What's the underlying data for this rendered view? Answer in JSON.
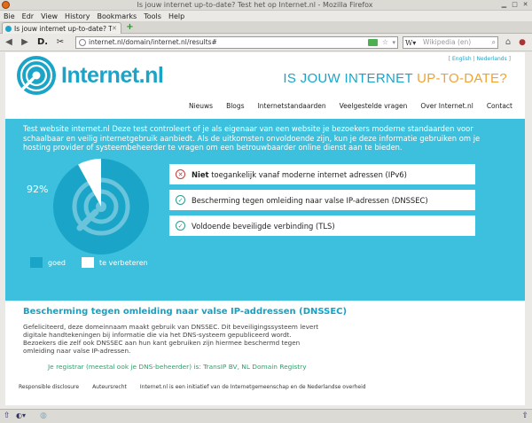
{
  "window": {
    "title": "Is jouw internet up-to-date? Test het op Internet.nl - Mozilla Firefox"
  },
  "menu": [
    "Bie",
    "Edr",
    "View",
    "History",
    "Bookmarks",
    "Tools",
    "Help"
  ],
  "tab": {
    "label": "Is jouw internet up-to-date? Test..."
  },
  "url": "internet.nl/domain/internet.nl/results#",
  "search": {
    "placeholder": "Wikipedia (en)"
  },
  "site": {
    "logo_text": "Internet.nl",
    "lang_prefix": "[ ",
    "lang_en": "English",
    "lang_sep": " | ",
    "lang_nl": "Nederlands",
    "lang_suffix": " ]",
    "tagline_main": "IS JOUW INTERNET ",
    "tagline_highlight": "UP-TO-DATE?",
    "nav": [
      "Nieuws",
      "Blogs",
      "Internetstandaarden",
      "Veelgestelde vragen",
      "Over Internet.nl",
      "Contact"
    ]
  },
  "intro": "Test website internet.nl Deze test controleert of je als eigenaar van een website je bezoekers moderne standaarden voor schaalbaar en veilig internetgebruik aanbiedt. Als de uitkomsten onvoldoende zijn, kun je deze informatie gebruiken om je hosting provider of systeembeheerder te vragen om een betrouwbaarder online dienst aan te bieden.",
  "score": {
    "label": "92%",
    "value": 92,
    "legend_good": "goed",
    "legend_improve": "te verbeteren"
  },
  "results": [
    {
      "status": "fail",
      "bold": "Niet",
      "text": " toegankelijk vanaf moderne internet adressen (IPv6)"
    },
    {
      "status": "ok",
      "bold": "",
      "text": "Bescherming tegen omleiding naar valse IP-adressen (DNSSEC)"
    },
    {
      "status": "ok",
      "bold": "",
      "text": "Voldoende beveiligde verbinding (TLS)"
    }
  ],
  "detail": {
    "heading": "Bescherming tegen omleiding naar valse IP-addressen (DNSSEC)",
    "body": "Gefeliciteerd, deze domeinnaam maakt gebruik van DNSSEC. Dit beveiligingssysteem levert digitale handtekeningen bij informatie die via het DNS-systeem gepubliceerd wordt. Bezoekers die zelf ook DNSSEC aan hun kant gebruiken zijn hiermee beschermd tegen omleiding naar valse IP-adressen.",
    "registrar": "Je registrar (meestal ook je DNS-beheerder) is: TransIP BV, NL Domain Registry"
  },
  "footer": [
    "Responsible disclosure",
    "Auteursrecht",
    "Internet.nl is een initiatief van de Internetgemeenschap en de Nederlandse overheid"
  ],
  "colors": {
    "brand": "#1aa5c8",
    "band": "#3cc0dd",
    "accent": "#f0a330",
    "fail": "#c23b3b",
    "ok": "#2b9b8f",
    "good": "#1aa5c8",
    "improve": "#ffffff"
  }
}
